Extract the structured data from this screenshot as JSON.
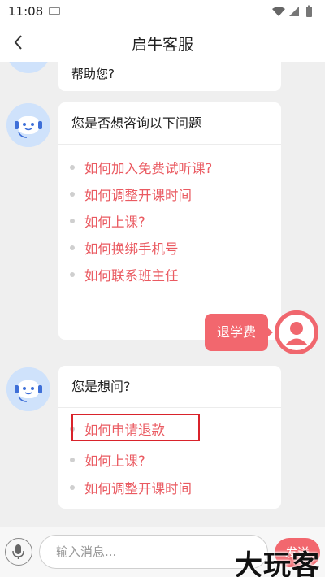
{
  "status_bar": {
    "time": "11:08"
  },
  "nav": {
    "title": "启牛客服"
  },
  "chat": {
    "partial_message": "帮助您?",
    "card1": {
      "heading": "您是否想咨询以下问题",
      "options": [
        "如何加入免费试听课?",
        "如何调整开课时间",
        "如何上课?",
        "如何换绑手机号",
        "如何联系班主任"
      ]
    },
    "user_message": "退学费",
    "card2": {
      "heading": "您是想问?",
      "options": [
        "如何申请退款",
        "如何上课?",
        "如何调整开课时间"
      ],
      "highlighted_option": "如何申请退款"
    }
  },
  "input_bar": {
    "placeholder": "输入消息...",
    "send_label": "发送"
  },
  "watermark": "大玩客",
  "colors": {
    "accent": "#f2676e",
    "option_text": "#ea5a61",
    "highlight_border": "#d9232b",
    "background": "#efefef"
  }
}
